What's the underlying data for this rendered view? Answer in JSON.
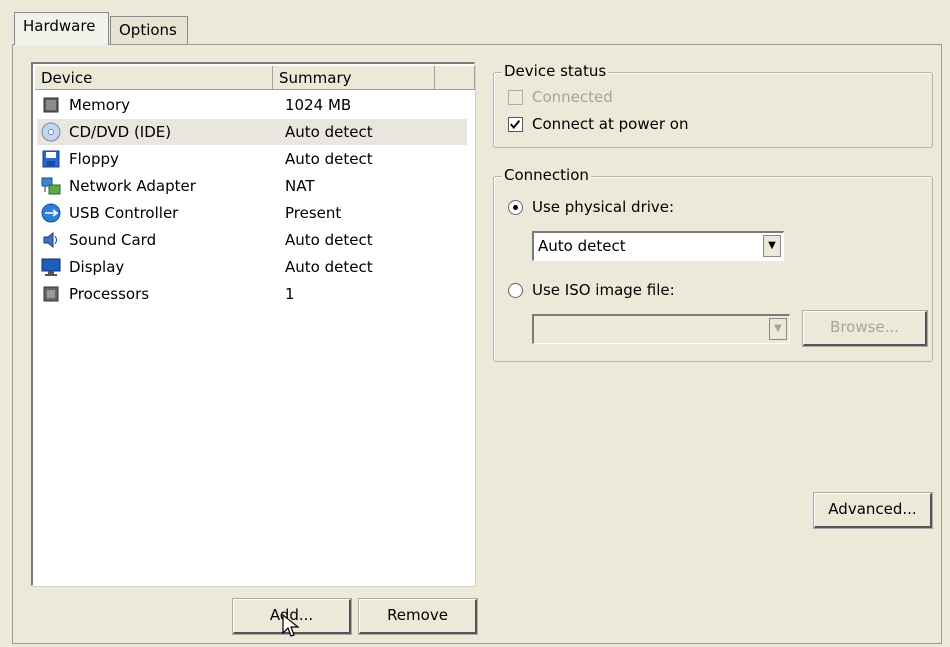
{
  "tabs": [
    {
      "label": "Hardware",
      "active": true
    },
    {
      "label": "Options",
      "active": false
    }
  ],
  "device_list": {
    "columns": [
      "Device",
      "Summary"
    ],
    "rows": [
      {
        "name": "Memory",
        "summary": "1024 MB",
        "icon": "memory-icon"
      },
      {
        "name": "CD/DVD (IDE)",
        "summary": "Auto detect",
        "icon": "cd-dvd-icon",
        "selected": true
      },
      {
        "name": "Floppy",
        "summary": "Auto detect",
        "icon": "floppy-icon"
      },
      {
        "name": "Network Adapter",
        "summary": "NAT",
        "icon": "network-adapter-icon"
      },
      {
        "name": "USB Controller",
        "summary": "Present",
        "icon": "usb-icon"
      },
      {
        "name": "Sound Card",
        "summary": "Auto detect",
        "icon": "sound-card-icon"
      },
      {
        "name": "Display",
        "summary": "Auto detect",
        "icon": "display-icon"
      },
      {
        "name": "Processors",
        "summary": "1",
        "icon": "processor-icon"
      }
    ]
  },
  "buttons": {
    "add": "Add...",
    "remove": "Remove",
    "browse": "Browse...",
    "advanced": "Advanced..."
  },
  "device_status": {
    "title": "Device status",
    "connected_label": "Connected",
    "connected_checked": false,
    "connected_enabled": false,
    "power_on_label": "Connect at power on",
    "power_on_checked": true
  },
  "connection": {
    "title": "Connection",
    "physical_label": "Use physical drive:",
    "physical_selected": true,
    "physical_value": "Auto detect",
    "iso_label": "Use ISO image file:",
    "iso_selected": false,
    "iso_value": ""
  }
}
